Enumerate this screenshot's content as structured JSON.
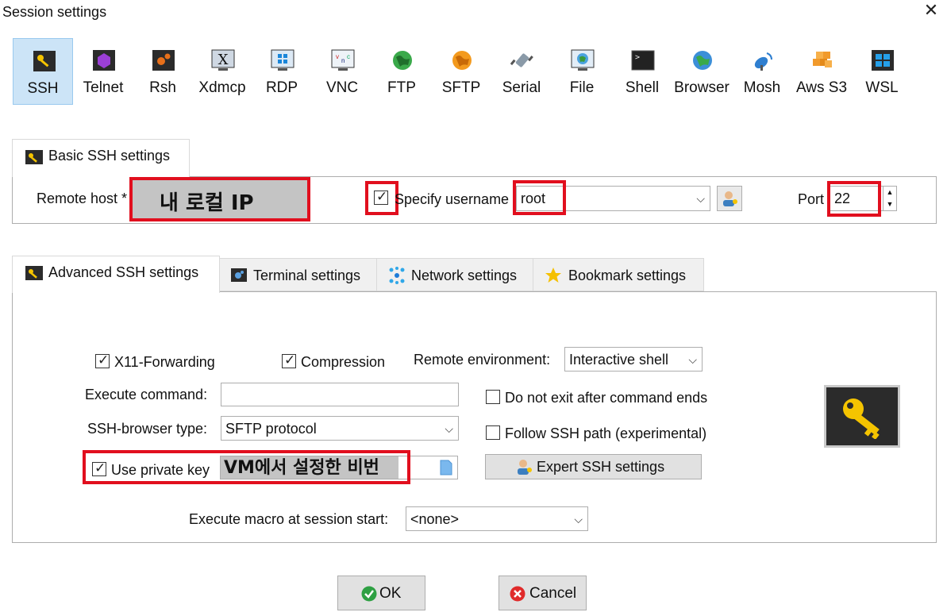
{
  "window": {
    "title": "Session settings",
    "close_glyph": "✕"
  },
  "protocols": [
    {
      "label": "SSH",
      "icon": "ssh-key-icon",
      "selected": true
    },
    {
      "label": "Telnet",
      "icon": "telnet-icon"
    },
    {
      "label": "Rsh",
      "icon": "rsh-icon"
    },
    {
      "label": "Xdmcp",
      "icon": "xdmcp-icon"
    },
    {
      "label": "RDP",
      "icon": "rdp-icon"
    },
    {
      "label": "VNC",
      "icon": "vnc-icon"
    },
    {
      "label": "FTP",
      "icon": "ftp-globe-icon"
    },
    {
      "label": "SFTP",
      "icon": "sftp-globe-icon"
    },
    {
      "label": "Serial",
      "icon": "serial-plug-icon"
    },
    {
      "label": "File",
      "icon": "file-icon"
    },
    {
      "label": "Shell",
      "icon": "shell-terminal-icon"
    },
    {
      "label": "Browser",
      "icon": "browser-globe-icon"
    },
    {
      "label": "Mosh",
      "icon": "mosh-satellite-icon"
    },
    {
      "label": "Aws S3",
      "icon": "aws-s3-icon"
    },
    {
      "label": "WSL",
      "icon": "wsl-windows-icon"
    }
  ],
  "basic": {
    "tab_label": "Basic SSH settings",
    "remote_host_label": "Remote host *",
    "remote_host_value": "내 로컬 IP",
    "specify_username_label": "Specify username",
    "specify_username_checked": true,
    "username_value": "root",
    "port_label": "Port",
    "port_value": "22"
  },
  "tabs": [
    {
      "label": "Advanced SSH settings",
      "icon": "key-icon",
      "active": true
    },
    {
      "label": "Terminal settings",
      "icon": "terminal-gear-icon"
    },
    {
      "label": "Network settings",
      "icon": "network-icon"
    },
    {
      "label": "Bookmark settings",
      "icon": "star-icon"
    }
  ],
  "advanced": {
    "x11_label": "X11-Forwarding",
    "compression_label": "Compression",
    "remote_env_label": "Remote environment:",
    "remote_env_value": "Interactive shell",
    "execute_cmd_label": "Execute command:",
    "execute_cmd_value": "",
    "do_not_exit_label": "Do not exit after command ends",
    "browser_type_label": "SSH-browser type:",
    "browser_type_value": "SFTP protocol",
    "follow_path_label": "Follow SSH path (experimental)",
    "private_key_label": "Use private key",
    "private_key_value": "VM에서 설정한 비번",
    "expert_btn": "Expert SSH settings",
    "macro_label": "Execute macro at session start:",
    "macro_value": "<none>"
  },
  "buttons": {
    "ok": "OK",
    "cancel": "Cancel"
  },
  "colors": {
    "highlight_red": "#e10f1e",
    "selected_bg": "#cce4f7",
    "ok_green": "#2ea043",
    "cancel_red": "#e02a2a"
  }
}
